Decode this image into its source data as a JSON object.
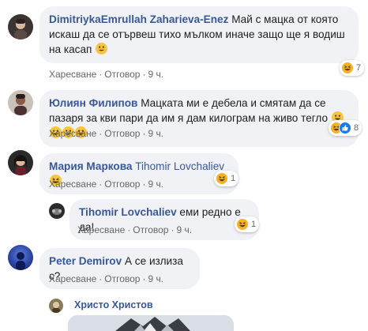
{
  "comments": [
    {
      "author": "DimitriykaEmrullah Zaharieva-Enez",
      "text": "Май с мацка от която искаш да се отървеш тихо мълком иначе защо ще я водиш на касап",
      "actions": {
        "like": "Харесване",
        "reply": "Отговор",
        "time": "9 ч."
      },
      "reaction_count": "7"
    },
    {
      "author": "Юлиян Филипов",
      "text": "Мацката ми е дебела и смятам да се пазаря за кви пари да им я дам килограм на живо тегло",
      "actions": {
        "like": "Харесване",
        "reply": "Отговор",
        "time": "9 ч."
      },
      "reaction_count": "8"
    },
    {
      "author": "Мария Маркова",
      "mention": "Tihomir Lovchaliev",
      "actions": {
        "like": "Харесване",
        "reply": "Отговор",
        "time": "9 ч."
      },
      "reaction_count": "1"
    },
    {
      "author": "Tihomir Lovchaliev",
      "text": "еми редно е да!",
      "actions": {
        "like": "Харесване",
        "reply": "Отговор",
        "time": "9 ч."
      },
      "reaction_count": "1"
    },
    {
      "author": "Peter Demirov",
      "text": "А се излиза с?",
      "actions": {
        "like": "Харесване",
        "reply": "Отговор",
        "time": "9 ч."
      }
    }
  ],
  "reply_preview": {
    "author": "Христо Христов"
  },
  "colors": {
    "link": "#385898",
    "bubble": "#f0f2f5",
    "meta": "#65676b",
    "haha": "#f7b125",
    "like": "#1877f2"
  },
  "icons": [
    "haha-reaction-icon",
    "like-reaction-icon",
    "grinning-emoji-icon"
  ]
}
